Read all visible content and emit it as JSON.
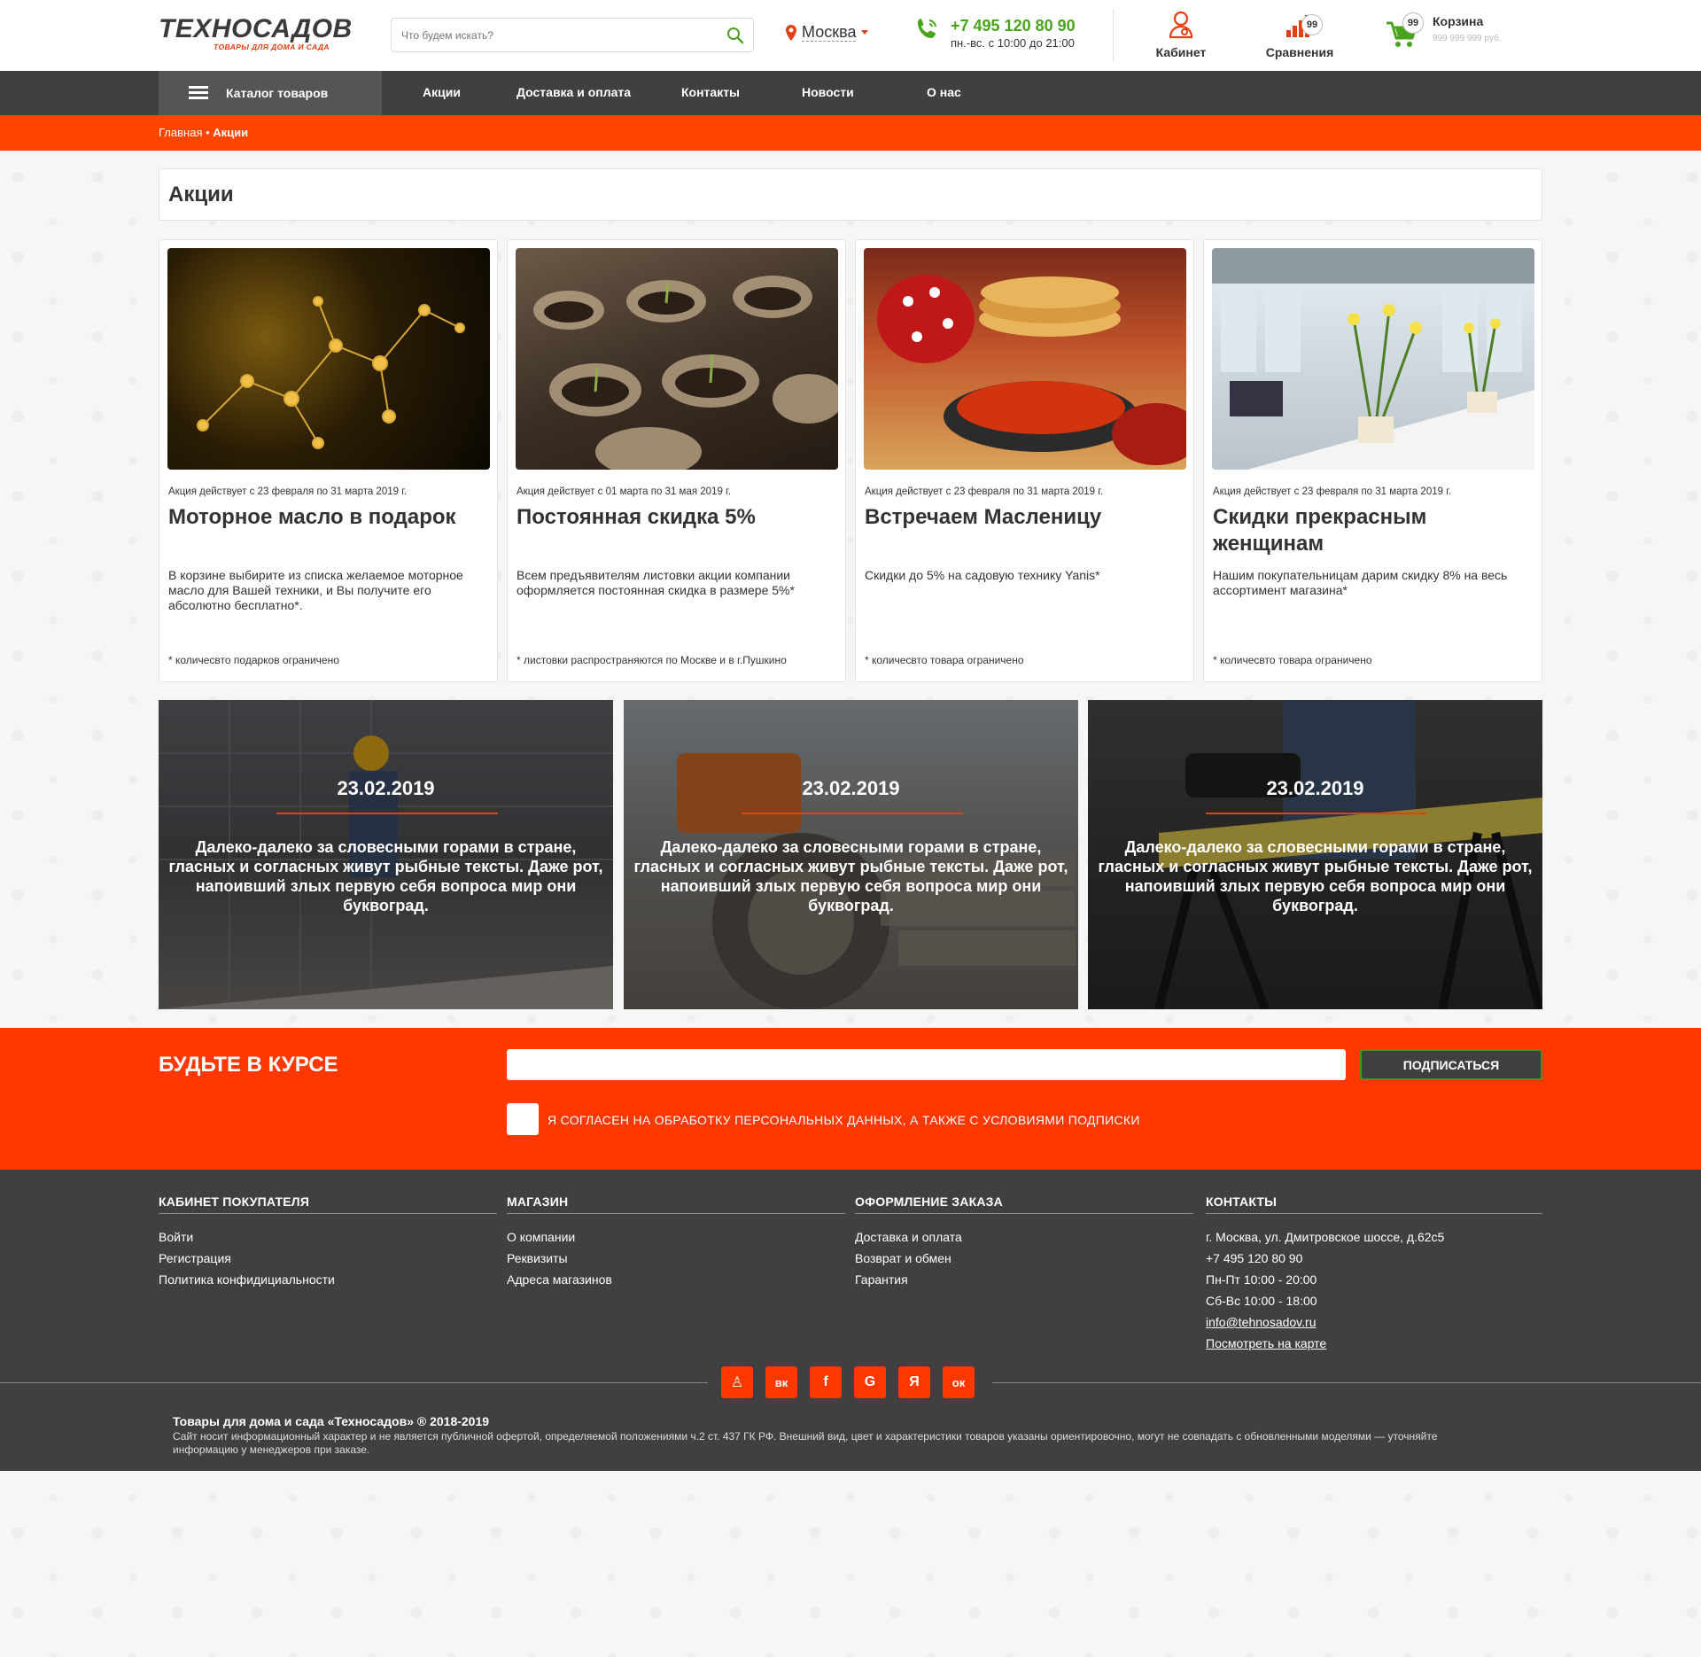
{
  "header": {
    "logo_main": "ТЕХНОСАДОВ",
    "logo_sub": "ТОВАРЫ ДЛЯ ДОМА И САДА",
    "search_placeholder": "Что будем искать?",
    "city": "Москва",
    "phone": "+7 495 120 80 90",
    "hours": "пн.-вс. с 10:00 до 21:00",
    "cabinet_label": "Кабинет",
    "compare_label": "Сравнения",
    "compare_count": "99",
    "cart_label": "Корзина",
    "cart_count": "99",
    "cart_sum": "999 999 999 руб."
  },
  "nav": {
    "catalog": "Каталог товаров",
    "items": [
      "Акции",
      "Доставка и оплата",
      "Контакты",
      "Новости",
      "О нас"
    ]
  },
  "breadcrumbs": {
    "home": "Главная",
    "separator": "•",
    "current": "Акции"
  },
  "page_title": "Акции",
  "promos": [
    {
      "date": "Акция действует с 23 февраля по 31 марта 2019 г.",
      "title": "Моторное масло в подарок",
      "text": "В корзине выбирите из списка желаемое моторное масло для Вашей техники, и Вы получите его абсолютно бесплатно*.",
      "note": "* количесвто подарков ограничено"
    },
    {
      "date": "Акция действует с 01 марта по 31 мая 2019 г.",
      "title": "Постоянная скидка 5%",
      "text": "Всем предъявителям листовки акции компании оформляется постоянная скидка в размере 5%*",
      "note": "* листовки распространяются по Москве и в г.Пушкино"
    },
    {
      "date": "Акция действует с 23 февраля по 31 марта 2019 г.",
      "title": "Встречаем Масленицу",
      "text": "Скидки до 5% на садовую технику Yanis*",
      "note": "* количесвто товара ограничено"
    },
    {
      "date": "Акция действует с 23 февраля по 31 марта 2019 г.",
      "title": "Скидки прекрасным женщинам",
      "text": "Нашим покупательницам дарим скидку 8% на весь ассортимент магазина*",
      "note": "* количесвто товара ограничено"
    }
  ],
  "banners": [
    {
      "date": "23.02.2019",
      "text": "Далеко-далеко за словесными горами в стране, гласных и согласных живут рыбные тексты. Даже рот, напоивший злых первую себя вопроса мир они буквоград."
    },
    {
      "date": "23.02.2019",
      "text": "Далеко-далеко за словесными горами в стране, гласных и согласных живут рыбные тексты. Даже рот, напоивший злых первую себя вопроса мир они буквоград."
    },
    {
      "date": "23.02.2019",
      "text": "Далеко-далеко за словесными горами в стране, гласных и согласных живут рыбные тексты. Даже рот, напоивший злых первую себя вопроса мир они буквоград."
    }
  ],
  "subscribe": {
    "title": "БУДЬТЕ В КУРСЕ",
    "button": "ПОДПИСАТЬСЯ",
    "agree": "Я СОГЛАСЕН НА ОБРАБОТКУ ПЕРСОНАЛЬНЫХ ДАННЫХ, А ТАКЖЕ С УСЛОВИЯМИ ПОДПИСКИ"
  },
  "footer": {
    "col1": {
      "title": "КАБИНЕТ ПОКУПАТЕЛЯ",
      "links": [
        "Войти",
        "Регистрация",
        "Политика конфидициальности"
      ]
    },
    "col2": {
      "title": "МАГАЗИН",
      "links": [
        "О компании",
        "Реквизиты",
        "Адреса магазинов"
      ]
    },
    "col3": {
      "title": "ОФОРМЛЕНИЕ ЗАКАЗА",
      "links": [
        "Доставка и оплата",
        "Возврат и обмен",
        "Гарантия"
      ]
    },
    "col4": {
      "title": "КОНТАКТЫ",
      "address": "г. Москва, ул. Дмитровское шоссе, д.62с5",
      "phone": "+7 495 120 80 90",
      "hours1": "Пн-Пт 10:00 - 20:00",
      "hours2": "Сб-Вс 10:00 - 18:00",
      "email": "info@tehnosadov.ru",
      "map": "Посмотреть на карте"
    },
    "socials": [
      "user-icon",
      "vk-icon",
      "facebook-icon",
      "google-icon",
      "yandex-icon",
      "odnoklassniki-icon"
    ],
    "social_glyphs": [
      "♙",
      "вк",
      "f",
      "G",
      "Я",
      "ок"
    ],
    "copy_title": "Товары для дома и сада «Техносадов» ® 2018-2019",
    "copy_text": "Сайт носит информационный характер и не является публичной офертой, определяемой положениями ч.2 ст. 437 ГК РФ. Внешний вид, цвет и характеристики товаров указаны ориентировочно, могут не совпадать с обновленными моделями — уточняйте информацию у менеджеров при заказе."
  },
  "colors": {
    "accent": "#ff4500",
    "green": "#4aa31c",
    "dark": "#404040"
  }
}
